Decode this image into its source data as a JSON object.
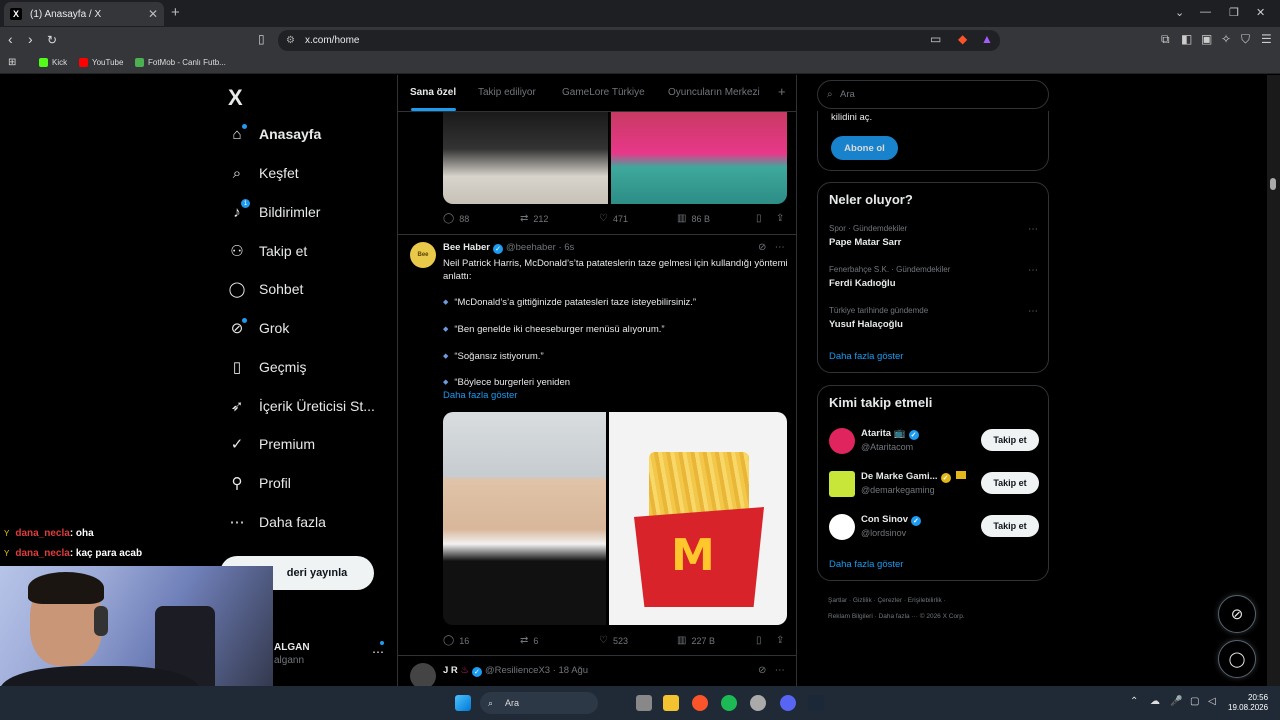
{
  "browser": {
    "tab_title": "(1) Anasayfa / X",
    "tab_icon": "X",
    "url": "x.com/home",
    "bookmarks": [
      {
        "label": "Kick",
        "color": "#53fc18"
      },
      {
        "label": "YouTube",
        "color": "#ff0000"
      },
      {
        "label": "FotMob - Canlı Futb...",
        "color": "#4caf50"
      }
    ]
  },
  "sidebar": {
    "logo": "X",
    "items": [
      {
        "label": "Anasayfa",
        "icon": "home-icon",
        "glyph": "⌂",
        "bold": true
      },
      {
        "label": "Keşfet",
        "icon": "search-icon",
        "glyph": "⌕"
      },
      {
        "label": "Bildirimler",
        "icon": "bell-icon",
        "glyph": "🔔",
        "badge": "1"
      },
      {
        "label": "Takip et",
        "icon": "add-user-icon",
        "glyph": "👤"
      },
      {
        "label": "Sohbet",
        "icon": "chat-icon",
        "glyph": "◯"
      },
      {
        "label": "Grok",
        "icon": "grok-icon",
        "glyph": "⊘"
      },
      {
        "label": "Geçmiş",
        "icon": "bookmark-icon",
        "glyph": "▯"
      },
      {
        "label": "İçerik Üreticisi St...",
        "icon": "rocket-icon",
        "glyph": "➶"
      },
      {
        "label": "Premium",
        "icon": "verified-icon",
        "glyph": "✓"
      },
      {
        "label": "Profil",
        "icon": "profile-icon",
        "glyph": "⚇"
      },
      {
        "label": "Daha fazla",
        "icon": "more-circle-icon",
        "glyph": "⋯"
      }
    ],
    "post_button": "Gönderi yayınla",
    "post_button_visible": "deri yayınla",
    "account_name": "ALGAN",
    "account_handle": "algann"
  },
  "feed_tabs": [
    "Sana özel",
    "Takip ediliyor",
    "GameLore Türkiye",
    "Oyuncuların Merkezi"
  ],
  "tweet1": {
    "replies": "88",
    "reposts": "212",
    "likes": "471",
    "views": "86 B"
  },
  "tweet2": {
    "name": "Bee Haber",
    "handle": "@beehaber",
    "time": "· 6s",
    "text": "Neil Patrick Harris, McDonald’s’ta patateslerin taze gelmesi için kullandığı yöntemi anlattı:",
    "bullets": [
      "“McDonald’s’a gittiğinizde patatesleri taze isteyebilirsiniz.”",
      "“Ben genelde iki cheeseburger menüsü alıyorum.”",
      "“Soğansız istiyorum.”",
      "“Böylece burgerleri yeniden"
    ],
    "show_more": "Daha fazla göster",
    "replies": "16",
    "reposts": "6",
    "likes": "523",
    "views": "227 B"
  },
  "tweet3": {
    "name": "J R",
    "handle": "@ResilienceX3",
    "time": "· 18 Ağu"
  },
  "right": {
    "search_placeholder": "Ara",
    "premium_text": "kilidini aç.",
    "subscribe_button": "Abone ol",
    "trends_title": "Neler oluyor?",
    "trends": [
      {
        "context": "Spor · Gündemdekiler",
        "name": "Pape Matar Sarr"
      },
      {
        "context": "Fenerbahçe S.K. · Gündemdekiler",
        "name": "Ferdi Kadıoğlu"
      },
      {
        "context": "Türkiye tarihinde gündemde",
        "name": "Yusuf Halaçoğlu"
      }
    ],
    "trends_more": "Daha fazla göster",
    "wtf_title": "Kimi takip etmeli",
    "who_to_follow": [
      {
        "name": "Atarita 📺",
        "handle": "@Ataritacom",
        "color": "#e0245e",
        "follow": "Takip et"
      },
      {
        "name": "De Marke Gami...",
        "handle": "@demarkegaming",
        "color": "#c8e63a",
        "follow": "Takip et"
      },
      {
        "name": "Con Sinov",
        "handle": "@lordsinov",
        "color": "#ffffff",
        "follow": "Takip et"
      }
    ],
    "wtf_more": "Daha fazla göster",
    "footer_line1": "Şartlar  ·  Gizlilik  ·  Çerezler  ·  Erişilebilirlik  ·",
    "footer_line2": "Reklam Bilgileri  ·  Daha fazla ···  © 2026 X Corp."
  },
  "chat": [
    {
      "user": "dana_necla",
      "msg": ": oha"
    },
    {
      "user": "dana_necla",
      "msg": ": kaç para acab"
    }
  ],
  "taskbar": {
    "search": "Ara",
    "time": "20:56",
    "date": "19.08.2026"
  }
}
